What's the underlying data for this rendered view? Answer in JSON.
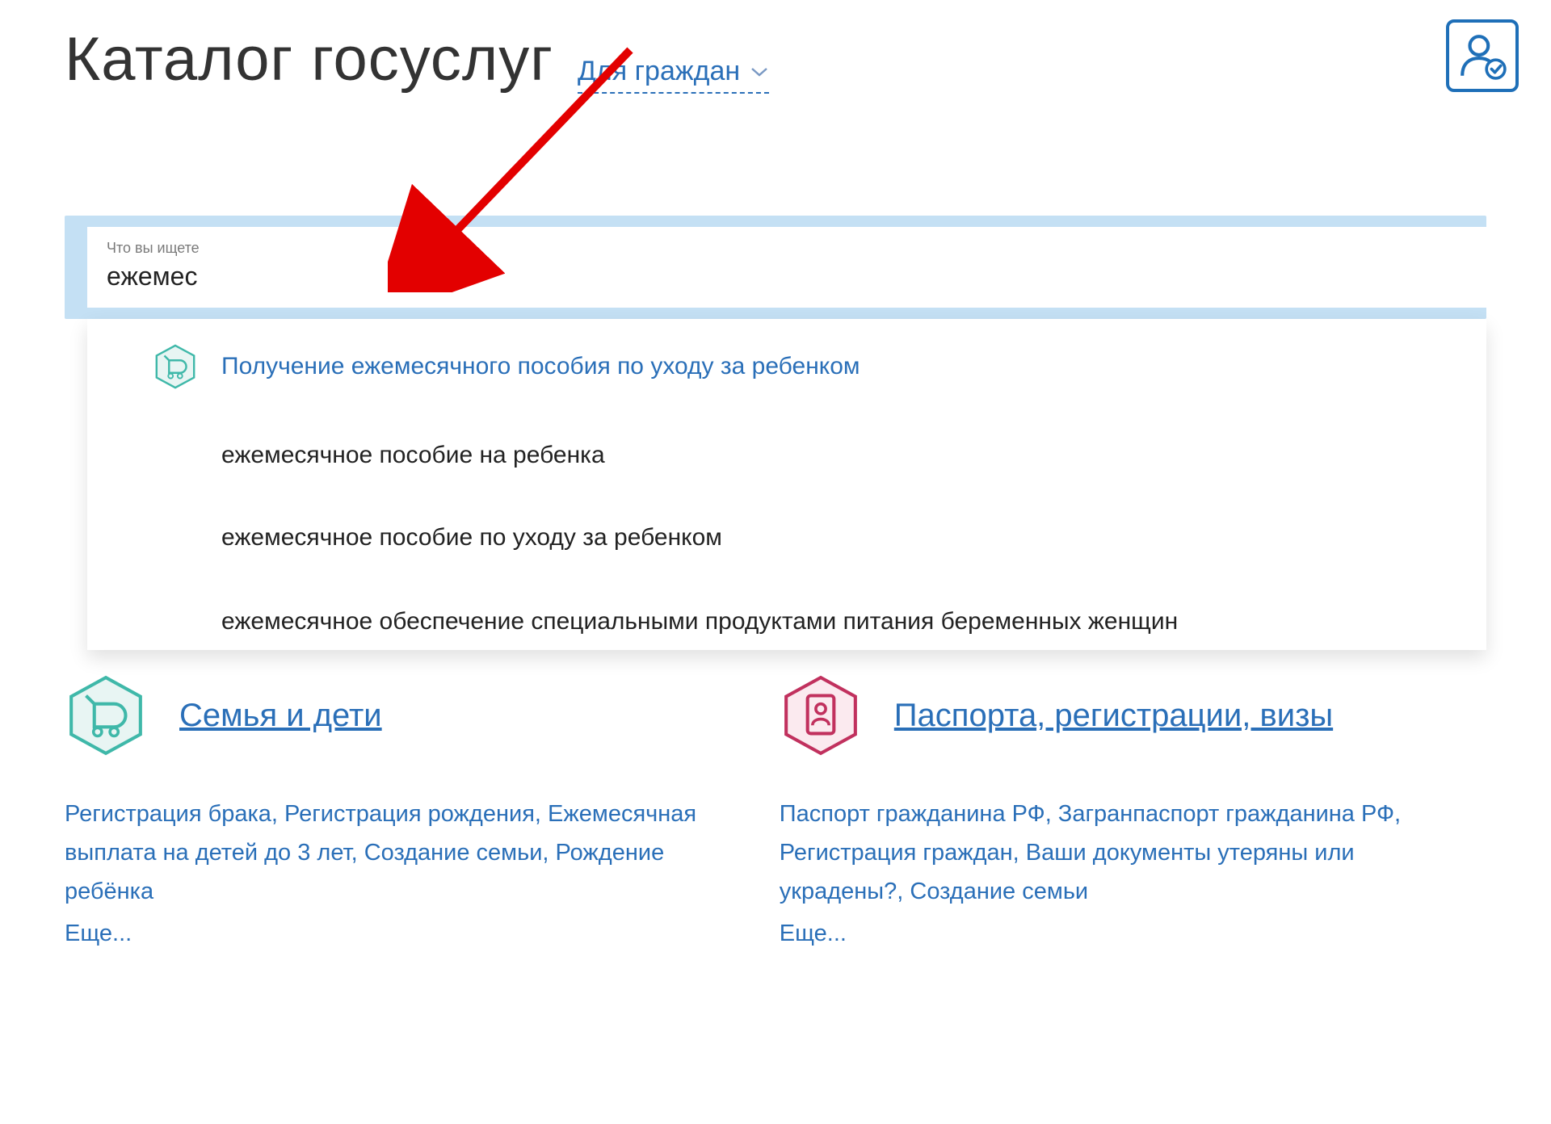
{
  "header": {
    "title": "Каталог госуслуг",
    "audience_label": "Для граждан"
  },
  "search": {
    "label": "Что вы ищете",
    "value": "ежемес"
  },
  "suggestions": {
    "primary": "Получение ежемесячного пособия по уходу за ребенком",
    "items": [
      "ежемесячное пособие на ребенка",
      "ежемесячное пособие по уходу за ребенком",
      "ежемесячное обеспечение специальными продуктами питания беременных женщин"
    ]
  },
  "categories": [
    {
      "title": "Семья и дети",
      "links": "Регистрация брака, Регистрация рождения, Ежемесячная выплата на детей до 3 лет, Создание семьи, Рождение ребёнка",
      "more": "Еще..."
    },
    {
      "title": "Паспорта, регистрации, визы",
      "links": "Паспорт гражданина РФ, Загранпаспорт гражданина РФ, Регистрация граждан, Ваши документы утеряны или украдены?, Создание семьи",
      "more": "Еще..."
    }
  ]
}
